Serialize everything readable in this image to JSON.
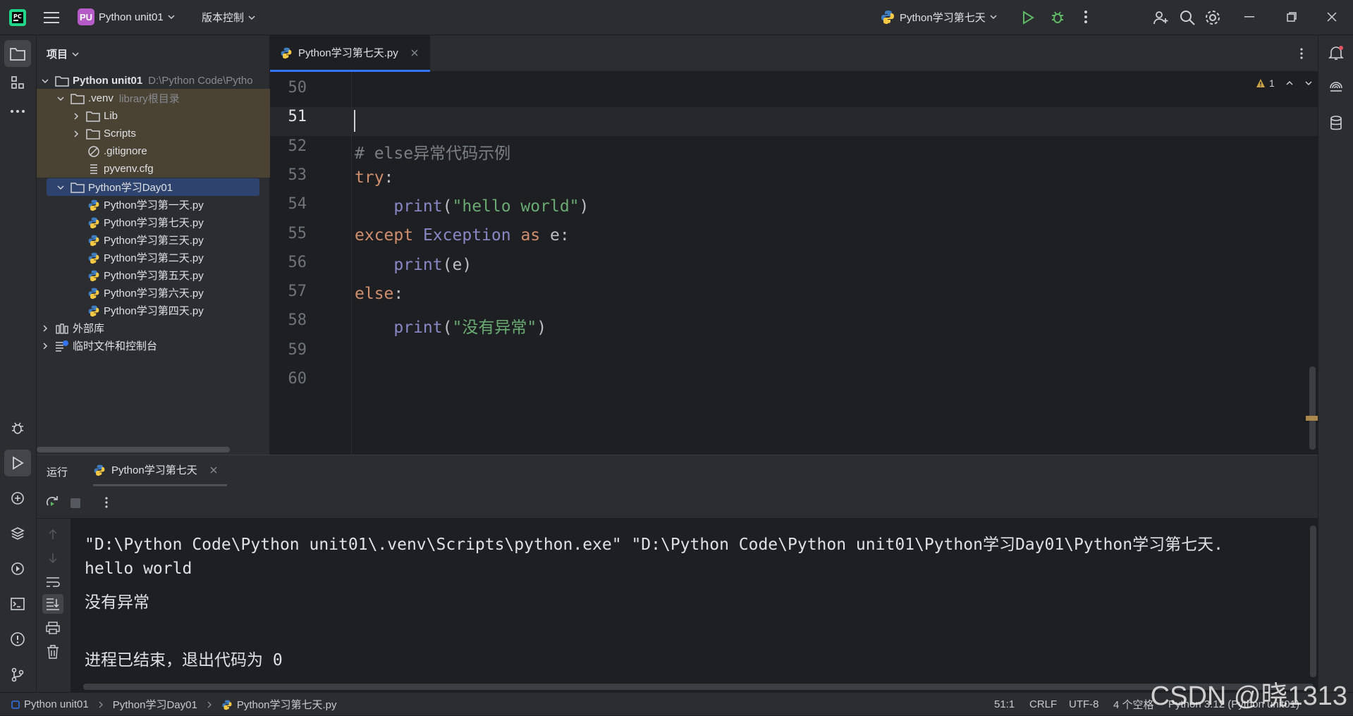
{
  "titlebar": {
    "project_badge": "PU",
    "project_name": "Python unit01",
    "vcs_label": "版本控制",
    "run_config": "Python学习第七天"
  },
  "project_panel": {
    "title": "项目",
    "root": {
      "name": "Python unit01",
      "path": "D:\\Python Code\\Pytho"
    },
    "venv": {
      "name": ".venv",
      "hint": "library根目录"
    },
    "items": [
      {
        "label": "Lib"
      },
      {
        "label": "Scripts"
      },
      {
        "label": ".gitignore"
      },
      {
        "label": "pyvenv.cfg"
      }
    ],
    "day_folder": "Python学习Day01",
    "files": [
      "Python学习第一天.py",
      "Python学习第七天.py",
      "Python学习第三天.py",
      "Python学习第二天.py",
      "Python学习第五天.py",
      "Python学习第六天.py",
      "Python学习第四天.py"
    ],
    "external_libs": "外部库",
    "scratches": "临时文件和控制台"
  },
  "editor": {
    "tab_title": "Python学习第七天.py",
    "warning_count": "1",
    "line_numbers": [
      "50",
      "51",
      "52",
      "53",
      "54",
      "55",
      "56",
      "57",
      "58",
      "59",
      "60"
    ],
    "lines": {
      "l52_comment": "# else异常代码示例",
      "l53_try": "try",
      "l54_print": "print",
      "l54_str": "\"hello world\"",
      "l55_except": "except",
      "l55_exc": "Exception",
      "l55_as": "as",
      "l55_var": "e",
      "l56_print": "print",
      "l56_arg": "e",
      "l57_else": "else",
      "l58_print": "print",
      "l58_str": "\"没有异常\""
    }
  },
  "run_panel": {
    "title": "运行",
    "tab": "Python学习第七天",
    "output": [
      "\"D:\\Python Code\\Python unit01\\.venv\\Scripts\\python.exe\" \"D:\\Python Code\\Python unit01\\Python学习Day01\\Python学习第七天.",
      "hello world",
      "没有异常",
      "",
      "进程已结束，退出代码为 0"
    ]
  },
  "statusbar": {
    "breadcrumb": [
      "Python unit01",
      "Python学习Day01",
      "Python学习第七天.py"
    ],
    "position": "51:1",
    "line_ending": "CRLF",
    "encoding": "UTF-8",
    "indent": "4 个空格",
    "interpreter": "Python 3.12 (Python unit01)"
  },
  "watermark": "CSDN @晓1313"
}
